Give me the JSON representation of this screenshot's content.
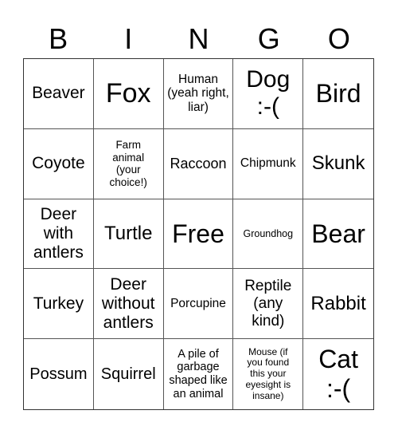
{
  "header": {
    "letters": [
      "B",
      "I",
      "N",
      "G",
      "O"
    ]
  },
  "grid": {
    "rows": [
      [
        "Beaver",
        "Fox",
        "Human (yeah right, liar)",
        "Dog :-(",
        "Bird"
      ],
      [
        "Coyote",
        "Farm animal (your choice!)",
        "Raccoon",
        "Chipmunk",
        "Skunk"
      ],
      [
        "Deer with antlers",
        "Turtle",
        "Free",
        "Groundhog",
        "Bear"
      ],
      [
        "Turkey",
        "Deer without antlers",
        "Porcupine",
        "Reptile (any kind)",
        "Rabbit"
      ],
      [
        "Possum",
        "Squirrel",
        "A pile of garbage shaped like an animal",
        "Mouse (if you found this your eyesight is insane)",
        "Cat :-("
      ]
    ]
  }
}
